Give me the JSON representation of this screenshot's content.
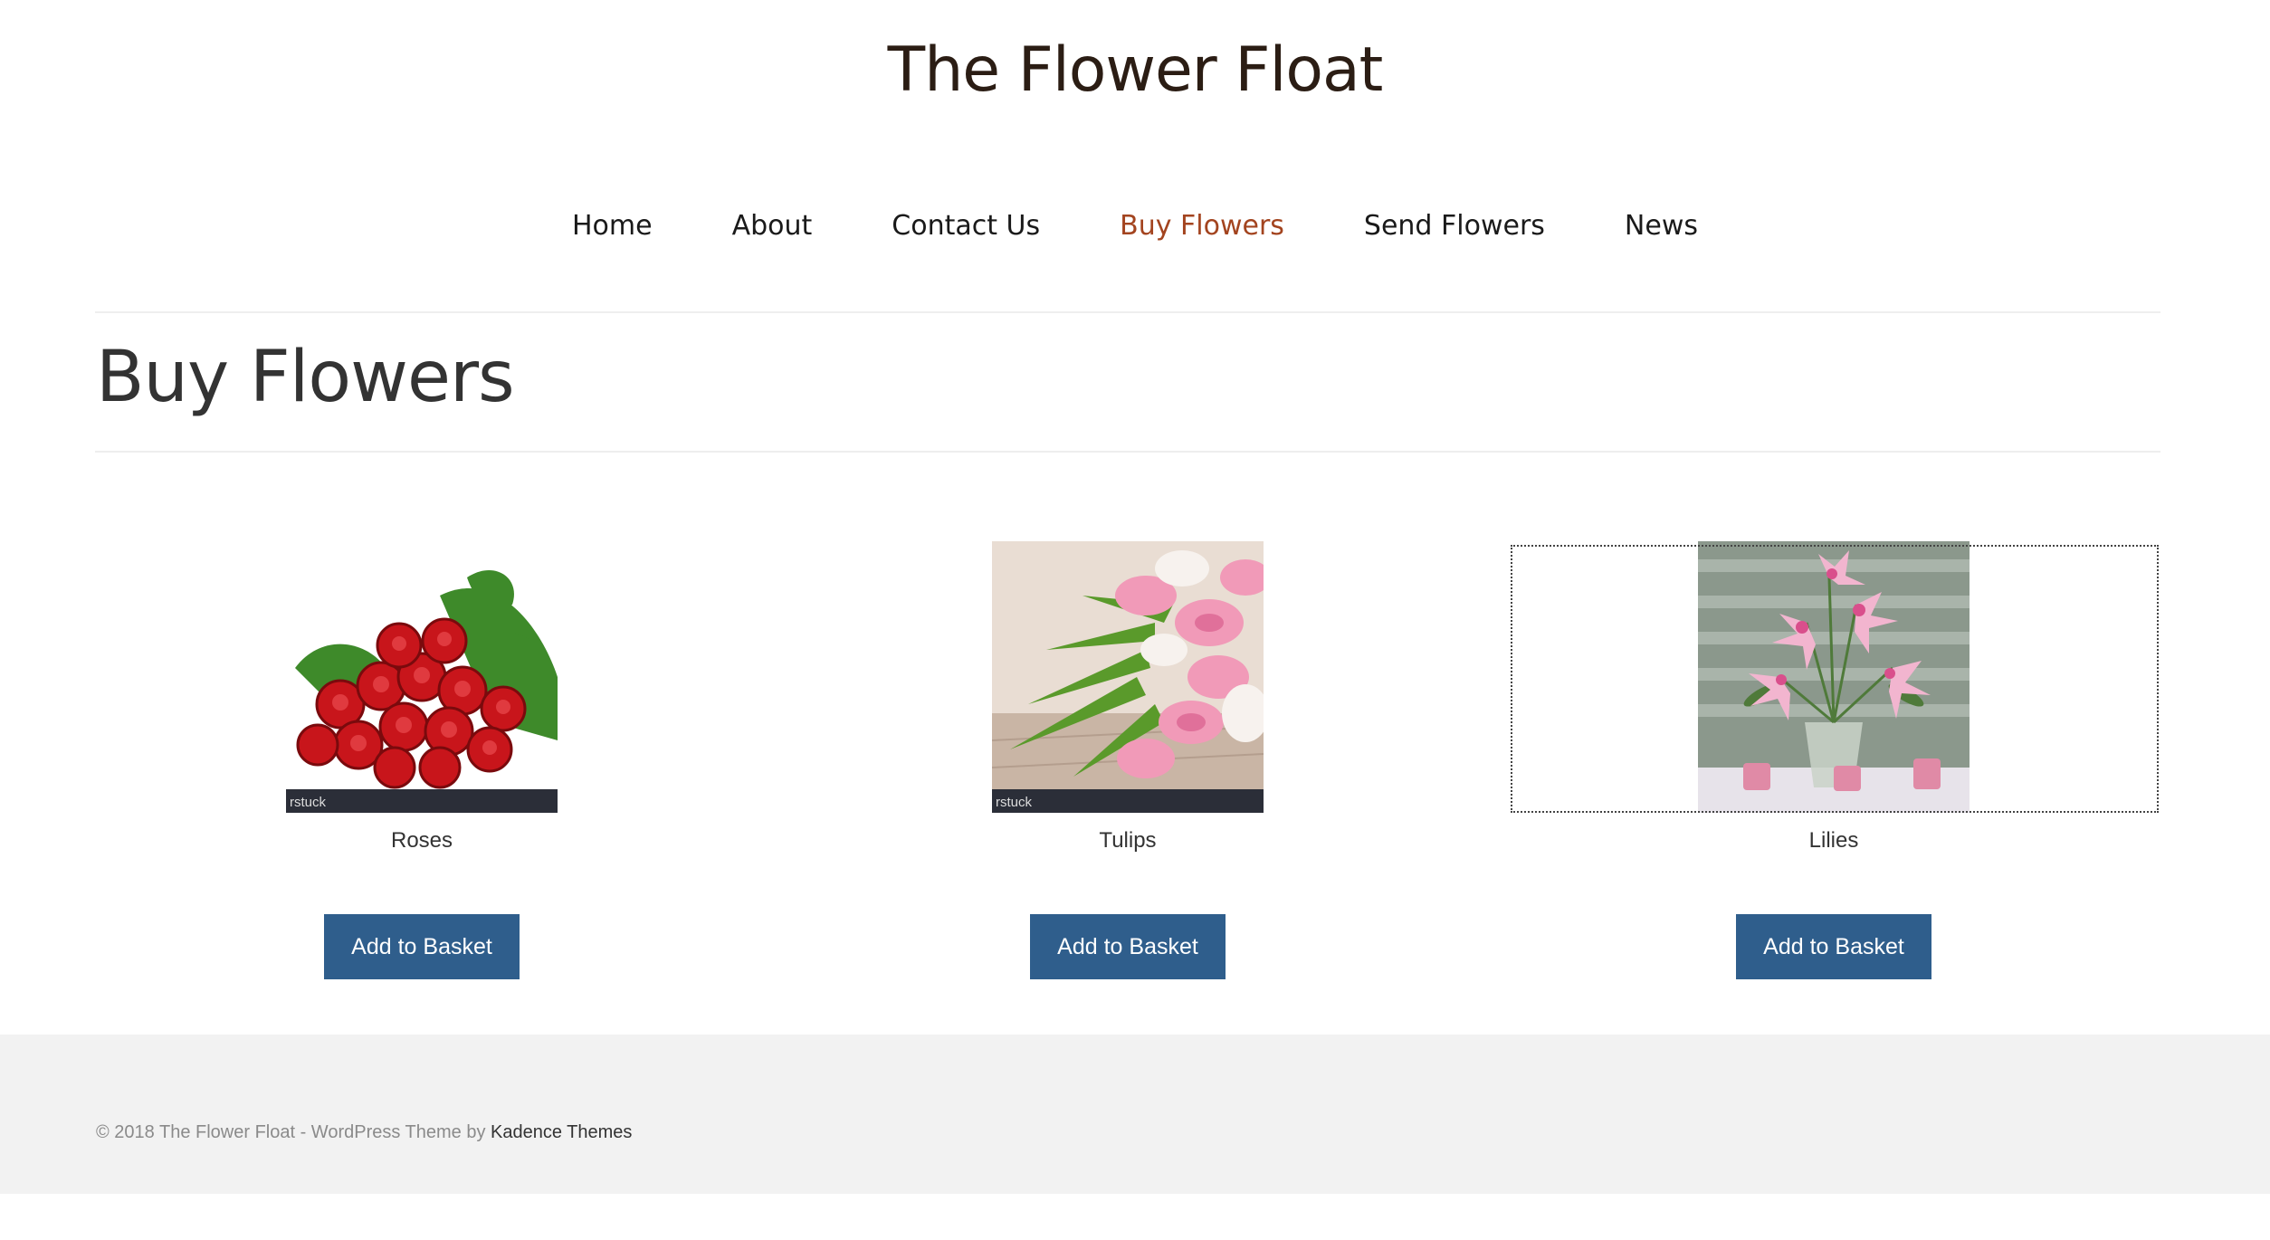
{
  "site": {
    "title": "The Flower Float"
  },
  "nav": {
    "items": [
      {
        "label": "Home",
        "active": false
      },
      {
        "label": "About",
        "active": false
      },
      {
        "label": "Contact Us",
        "active": false
      },
      {
        "label": "Buy Flowers",
        "active": true
      },
      {
        "label": "Send Flowers",
        "active": false
      },
      {
        "label": "News",
        "active": false
      }
    ]
  },
  "page": {
    "title": "Buy Flowers"
  },
  "products": [
    {
      "name": "Roses",
      "button_label": "Add to Basket",
      "image_watermark": "rstuck"
    },
    {
      "name": "Tulips",
      "button_label": "Add to Basket",
      "image_watermark": "rstuck"
    },
    {
      "name": "Lilies",
      "button_label": "Add to Basket"
    }
  ],
  "footer": {
    "text": "© 2018 The Flower Float - WordPress Theme by ",
    "credit_link": "Kadence Themes"
  },
  "colors": {
    "accent_nav": "#a3441f",
    "button": "#2f5e8c",
    "footer_bg": "#f2f2f2"
  }
}
